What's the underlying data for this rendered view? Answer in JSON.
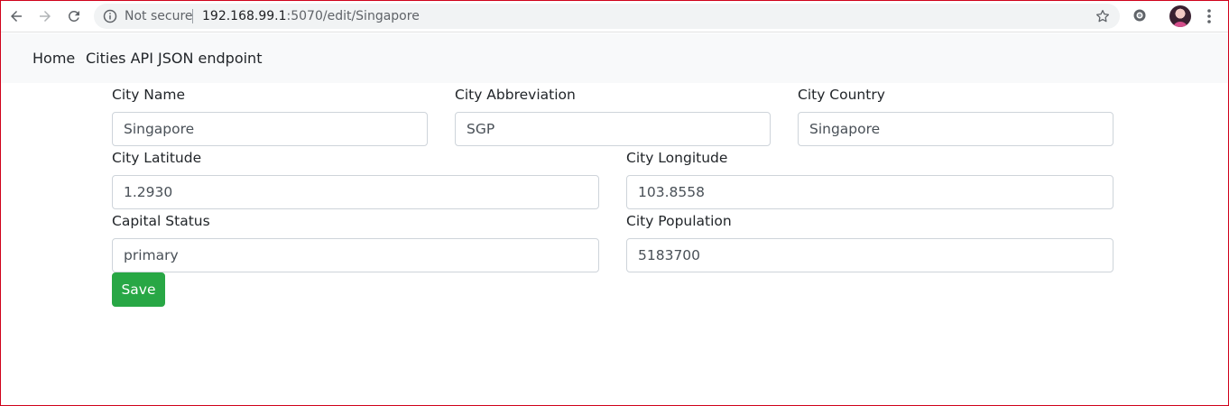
{
  "browser": {
    "security_label": "Not secure",
    "url_host": "192.168.99.1",
    "url_path": ":5070/edit/Singapore"
  },
  "navbar": {
    "links": [
      "Home",
      "Cities API JSON endpoint"
    ]
  },
  "form": {
    "city_name": {
      "label": "City Name",
      "value": "Singapore"
    },
    "city_abbreviation": {
      "label": "City Abbreviation",
      "value": "SGP"
    },
    "city_country": {
      "label": "City Country",
      "value": "Singapore"
    },
    "city_latitude": {
      "label": "City Latitude",
      "value": "1.2930"
    },
    "city_longitude": {
      "label": "City Longitude",
      "value": "103.8558"
    },
    "capital_status": {
      "label": "Capital Status",
      "value": "primary"
    },
    "city_population": {
      "label": "City Population",
      "value": "5183700"
    },
    "save_label": "Save"
  },
  "colors": {
    "accent_save": "#28a745",
    "navbar_bg": "#f8f9fa",
    "frame_border": "#d0021b"
  },
  "icons": [
    "back-arrow-icon",
    "forward-arrow-icon",
    "reload-icon",
    "info-icon",
    "star-icon",
    "extension-icon",
    "avatar",
    "kebab-menu-icon"
  ]
}
